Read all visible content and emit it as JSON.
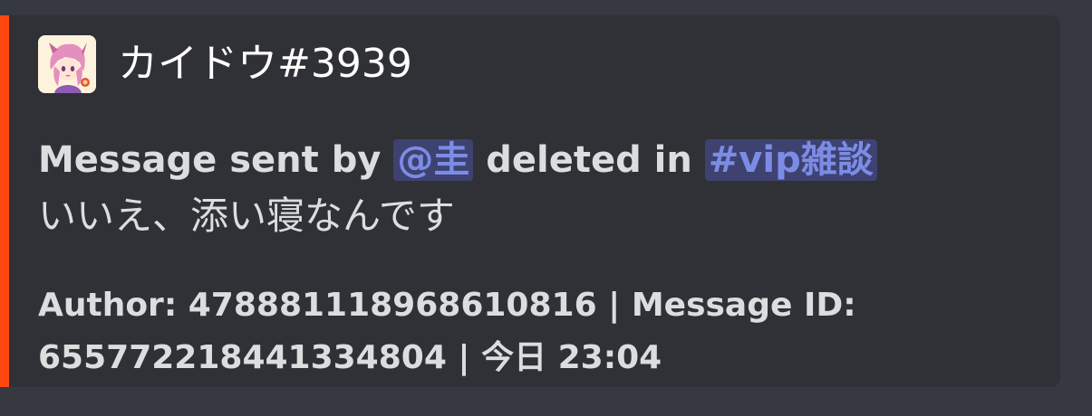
{
  "embed": {
    "accent_color": "#ff470f",
    "author": {
      "avatar_icon": "anime-character-avatar-icon",
      "name": "カイドウ#3939"
    },
    "description": {
      "prefix": "Message sent by ",
      "user_mention": "@圭",
      "middle": " deleted in ",
      "channel_mention": "#vip雑談",
      "content": "いいえ、添い寝なんです"
    },
    "footer": {
      "line1": "Author: 478881118968610816 | Message ID:",
      "line2": "655772218441334804 | 今日 23:04"
    }
  }
}
